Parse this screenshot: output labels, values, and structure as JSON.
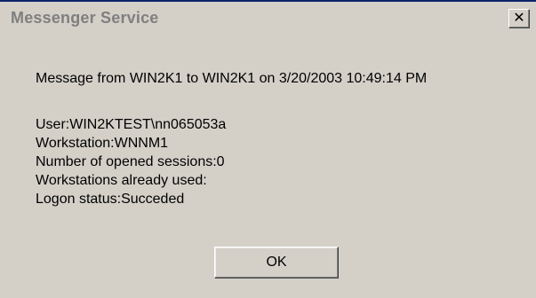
{
  "dialog": {
    "title": "Messenger Service",
    "close_symbol": "✕",
    "message_header": "Message from WIN2K1 to WIN2K1 on 3/20/2003 10:49:14 PM",
    "lines": [
      "User:WIN2KTEST\\nn065053a",
      "Workstation:WNNM1",
      "Number of opened sessions:0",
      "Workstations already used:",
      "Logon status:Succeded"
    ],
    "ok_label": "OK"
  },
  "icons": {
    "close": "close-icon"
  },
  "colors": {
    "dialog_background": "#d4d0c8",
    "title_text": "#7f7f7f"
  }
}
